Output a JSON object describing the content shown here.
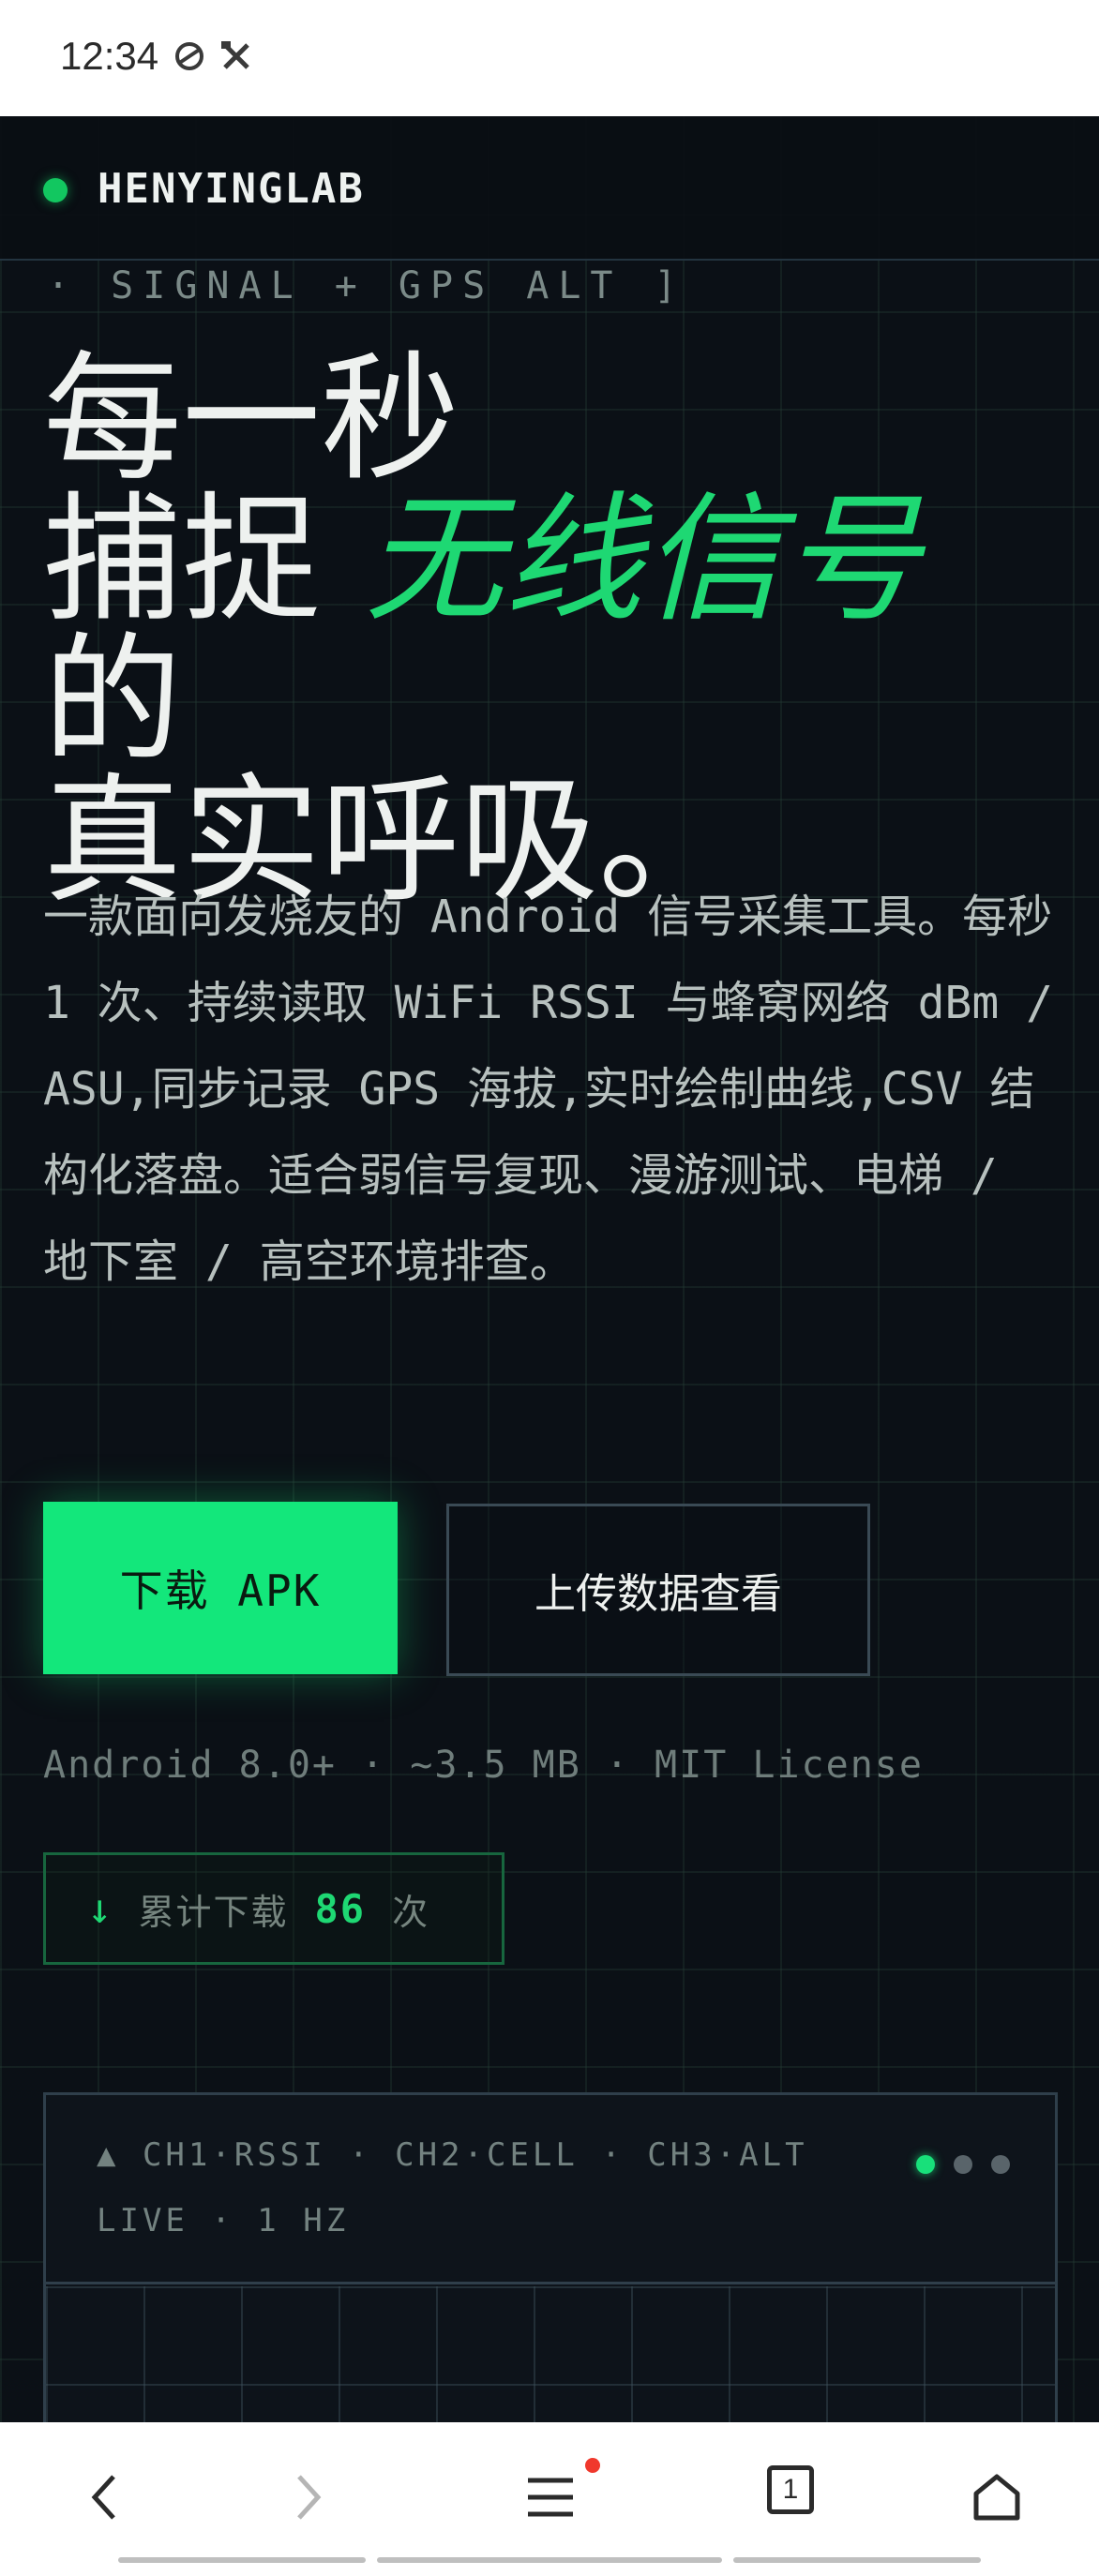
{
  "status_bar": {
    "time": "12:34"
  },
  "brand": {
    "name": "HENYINGLAB"
  },
  "eyebrow": "· SIGNAL + GPS ALT ]",
  "headline": {
    "line1": "每一秒",
    "line2_pre": "捕捉 ",
    "line2_accent": "无线信号",
    "line2_post": " 的",
    "line3": "真实呼吸。"
  },
  "description": "一款面向发烧友的 Android 信号采集工具。每秒 1 次、持续读取 WiFi RSSI 与蜂窝网络 dBm / ASU,同步记录 GPS 海拔,实时绘制曲线,CSV 结构化落盘。适合弱信号复现、漫游测试、电梯 / 地下室 / 高空环境排查。",
  "buttons": {
    "download": "下载 APK",
    "upload": "上传数据查看"
  },
  "meta": "Android 8.0+ · ~3.5 MB · MIT License",
  "counter": {
    "arrow": "↓",
    "prefix": "累计下载",
    "value": "86",
    "suffix": "次"
  },
  "monitor": {
    "channels": "▲ CH1·RSSI · CH2·CELL · CH3·ALT",
    "status": "LIVE · 1 HZ"
  },
  "colors": {
    "accent": "#13e77b",
    "background": "#0b1016"
  },
  "bottom_nav": {
    "tab_count": "1"
  }
}
